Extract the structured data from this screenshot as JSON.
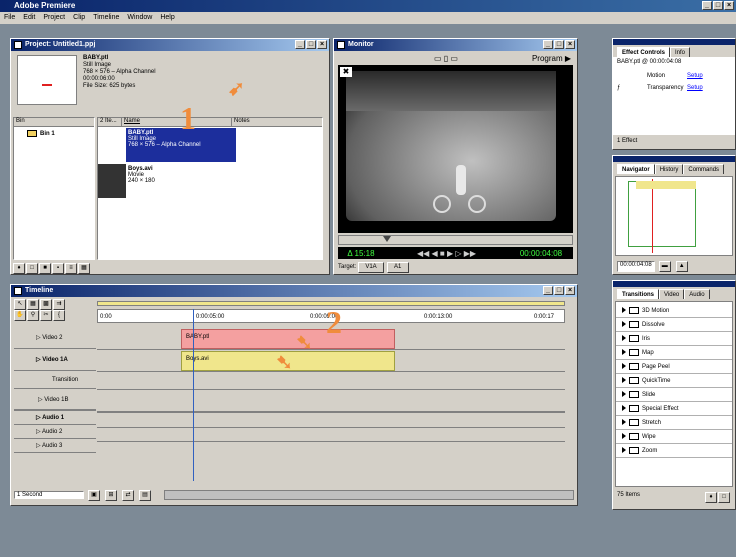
{
  "app": {
    "title": "Adobe Premiere",
    "menu": [
      "File",
      "Edit",
      "Project",
      "Clip",
      "Timeline",
      "Window",
      "Help"
    ]
  },
  "project": {
    "title": "Project: Untitled1.ppj",
    "preview": {
      "name": "BABY.ptl",
      "type": "Still Image",
      "dims": "768 × 576 – Alpha Channel",
      "duration": "00:00:06:00",
      "filesize": "File Size: 625 bytes"
    },
    "bins_header": "Bin",
    "bins": [
      "Bin 1"
    ],
    "columns": [
      "2 Ite...",
      "Name",
      "Notes"
    ],
    "items": [
      {
        "name": "BABY.ptl",
        "type": "Still Image",
        "detail": "768 × 576 – Alpha Channel"
      },
      {
        "name": "Boys.avi",
        "type": "Movie",
        "detail": "240 × 180"
      }
    ]
  },
  "monitor": {
    "title": "Monitor",
    "view": "Program",
    "delta": "Δ 15:18",
    "timecode": "00:00:04:08",
    "target_label": "Target:",
    "target_video": "V1A",
    "target_audio": "A1"
  },
  "effect_controls": {
    "tabs": [
      "Effect Controls",
      "Info"
    ],
    "clip": "BABY.ptl @ 00:00:04:08",
    "effects": [
      {
        "name": "Motion",
        "setup": "Setup"
      },
      {
        "name": "Transparency",
        "setup": "Setup"
      }
    ],
    "footer": "1 Effect"
  },
  "navigator": {
    "tabs": [
      "Navigator",
      "History",
      "Commands"
    ],
    "timecode": "00:00:04:08"
  },
  "transitions": {
    "tabs": [
      "Transitions",
      "Video",
      "Audio"
    ],
    "items": [
      "3D Motion",
      "Dissolve",
      "Iris",
      "Map",
      "Page Peel",
      "QuickTime",
      "Slide",
      "Special Effect",
      "Stretch",
      "Wipe",
      "Zoom"
    ],
    "footer": "75 Items"
  },
  "timeline": {
    "title": "Timeline",
    "ruler": [
      "0:00",
      "0:00:05:00",
      "0:00:09:00",
      "0:00:13:00",
      "0:00:17"
    ],
    "tracks": [
      "Video 2",
      "Video 1A",
      "Transition",
      "Video 1B",
      "Audio 1",
      "Audio 2",
      "Audio 3"
    ],
    "clip_video2": "BABY.ptl",
    "clip_video1a": "Boys.avi",
    "scale": "1 Second"
  },
  "annotations": {
    "one": "1",
    "two": "2"
  },
  "colors": {
    "accent": "#0a246a",
    "annotation": "#f08c3c",
    "clip_pink": "#f4a0a0",
    "clip_yellow": "#f0e68c",
    "selection": "#1c2e9c"
  }
}
